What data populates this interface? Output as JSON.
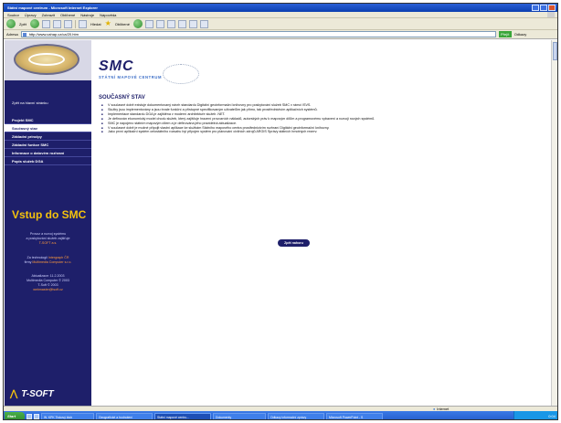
{
  "window": {
    "title": "Státní mapové centrum - Microsoft Internet Explorer"
  },
  "menu": [
    "Soubor",
    "Úpravy",
    "Zobrazit",
    "Oblíbené",
    "Nástroje",
    "Nápověda"
  ],
  "toolbar": {
    "back_label": "Zpět",
    "search_label": "Hledat",
    "favorites_label": "Oblíbené"
  },
  "address": {
    "label": "Adresa",
    "value": "http://www.cahap.cz/ca/20.htm",
    "go_label": "Přejít",
    "links_label": "Odkazy"
  },
  "sidebar": {
    "home_link": "Zpět na hlavní stránku",
    "nav": [
      {
        "label": "Projekt SMC"
      },
      {
        "label": "Současný stav"
      },
      {
        "label": "Základní principy"
      },
      {
        "label": "Základní funkce SMC"
      },
      {
        "label": "Informace o datovém rozhraní"
      },
      {
        "label": "Popis služeb DGA"
      }
    ],
    "vstup": "Vstup do SMC",
    "info1_a": "Provoz a rozvoj systému",
    "info1_b": "a poskytování služeb zajišťuje",
    "info1_c": "T-SOFT a.s.",
    "info2_a": "Za technologii",
    "info2_b": "Intergraph ČR",
    "info2_c": "firmy",
    "info2_d": "Multimedia Computer s.r.o.",
    "info3_a": "Aktualizace: 11.2.2003",
    "info3_b": "Multimedia Computer © 2003",
    "info3_c": "T-Soft © 2003",
    "info3_d": "webmaster@tsoft.cz",
    "brand": "T-SOFT"
  },
  "header": {
    "logo": "SMC",
    "subtitle": "STÁTNÍ MAPOVÉ CENTRUM"
  },
  "main": {
    "heading": "SOUČASNÝ STAV",
    "bullets": [
      "V současné době existuje dokumentovaný návrh standardu Digitální geoinformační knihovny pro poskytování služeb SMC v rámci ISVS.",
      "Služby jsou implementovány a jsou trvale funkční a přístupné specifikovaným uživatelům jak přímo, tak prostřednictvím aplikačních systémů.",
      "Implementace standardu DGA je zajištěna v moderní architektuře služeb .NET.",
      "Je definován ekonomický model chodu služeb, který zajišťuje hrazení provozních nákladů, autorských práv k mapovým dílům a programovému vybavení a rozvoji nových systémů.",
      "SMC je napojeno státním mapovým dílem a je definována jeho pravidelná aktualizace.",
      "V současné době je možné připojit vlastní aplikace ke službám Státního mapového centra prostřednictvím rozhraní Digitální geoinformační knihovny.",
      "Jako první aplikační systém celostátního rozsahu byl připojen systém pro plánování civilních zdrojů ARGIS Správy státních hmotných rezerv."
    ],
    "back_button": "Zpět nahoru"
  },
  "status": {
    "zone": "Internet"
  },
  "taskbar": {
    "start": "Start",
    "tasks": [
      "W. KPK Tiskový klub",
      "Geografické a hodnotení",
      "Státní mapové centru...",
      "Dokumenty",
      "Odkazy informační zprávy",
      "Microsoft PowerPoint - S"
    ],
    "clock": "0:04"
  },
  "colors": {
    "sidebar": "#1e1f6a",
    "accent_yellow": "#f4c20d",
    "link_orange": "#ff9a3c"
  }
}
